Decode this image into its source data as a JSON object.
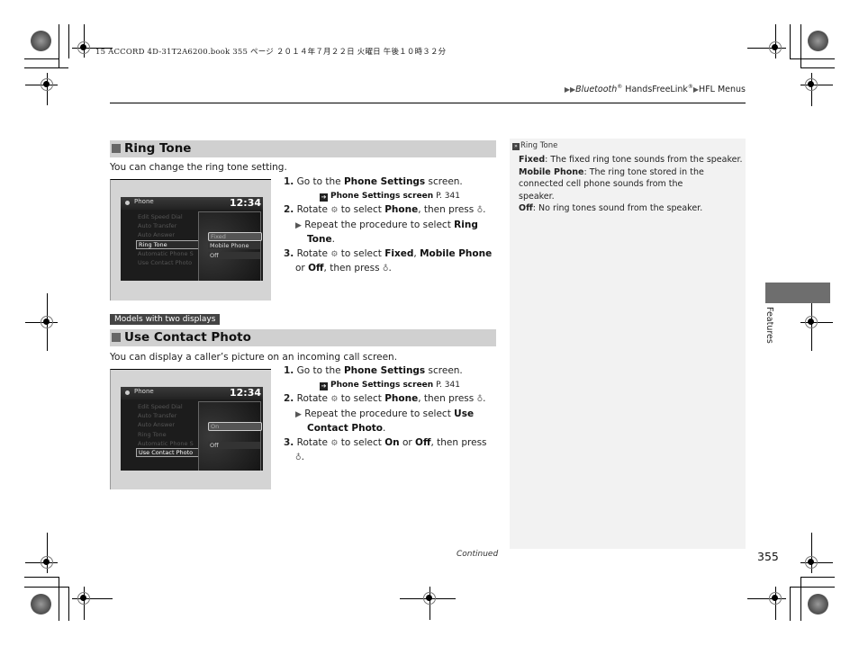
{
  "print_header": "15 ACCORD 4D-31T2A6200.book  355 ページ  ２０１４年７月２２日  火曜日  午後１０時３２分",
  "breadcrumb": {
    "arrow": "▶▶",
    "part1": "Bluetooth",
    "reg1": "®",
    "part2": " HandsFreeLink",
    "reg2": "®",
    "arrow2": "▶",
    "part3": "HFL Menus"
  },
  "sections": [
    {
      "title": "Ring Tone",
      "intro": "You can change the ring tone setting.",
      "screen": {
        "title": "Phone",
        "time": "12:34",
        "menu_items": [
          "Edit Speed Dial",
          "Auto Transfer",
          "Auto Answer",
          "Ring Tone",
          "Automatic Phone S",
          "Use Contact Photo"
        ],
        "selected_menu": "Ring Tone",
        "options": [
          "Fixed",
          "Mobile Phone",
          "Off"
        ],
        "selected_option": "Fixed"
      },
      "steps": {
        "s1_num": "1.",
        "s1_pre": " Go to the ",
        "s1_bold": "Phone Settings",
        "s1_post": " screen.",
        "ref_bold": "Phone Settings screen",
        "ref_page": " P. 341",
        "s2_num": "2.",
        "s2_pre": " Rotate ",
        "s2_mid": " to select ",
        "s2_bold": "Phone",
        "s2_post": ", then press ",
        "s2_sub_pre": "Repeat the procedure to select ",
        "s2_sub_bold1": "Ring",
        "s2_sub_bold2": "Tone",
        "s2_sub_post": ".",
        "s3_num": "3.",
        "s3_pre": " Rotate ",
        "s3_mid": " to select ",
        "s3_b1": "Fixed",
        "s3_c1": ", ",
        "s3_b2": "Mobile Phone",
        "s3_line2_pre": "or ",
        "s3_b3": "Off",
        "s3_post": ", then press "
      }
    },
    {
      "badge": "Models with two displays",
      "title": "Use Contact Photo",
      "intro": "You can display a caller’s picture on an incoming call screen.",
      "screen": {
        "title": "Phone",
        "time": "12:34",
        "menu_items": [
          "Edit Speed Dial",
          "Auto Transfer",
          "Auto Answer",
          "Ring Tone",
          "Automatic Phone S",
          "Use Contact Photo"
        ],
        "selected_menu": "Use Contact Photo",
        "options": [
          "On",
          "Off"
        ],
        "selected_option": "On"
      },
      "steps": {
        "s1_num": "1.",
        "s1_pre": " Go to the ",
        "s1_bold": "Phone Settings",
        "s1_post": " screen.",
        "ref_bold": "Phone Settings screen",
        "ref_page": " P. 341",
        "s2_num": "2.",
        "s2_pre": " Rotate ",
        "s2_mid": " to select ",
        "s2_bold": "Phone",
        "s2_post": ", then press ",
        "s2_sub_pre": "Repeat the procedure to select ",
        "s2_sub_bold1": "Use",
        "s2_sub_bold2": "Contact Photo",
        "s2_sub_post": ".",
        "s3_num": "3.",
        "s3_pre": " Rotate ",
        "s3_mid": " to select ",
        "s3_b1": "On",
        "s3_c1": " or ",
        "s3_b2": "Off",
        "s3_post": ", then press"
      }
    }
  ],
  "sidebar": {
    "ref_icon": "»",
    "title": "Ring Tone",
    "entries": [
      {
        "term": "Fixed",
        "desc": ": The fixed ring tone sounds from the speaker."
      },
      {
        "term": "Mobile Phone",
        "desc": ": The ring tone stored in the connected cell phone sounds from the speaker."
      },
      {
        "term": "Off",
        "desc": ": No ring tones sound from the speaker."
      }
    ]
  },
  "side_tab": "Features",
  "continued": "Continued",
  "page_number": "355",
  "icons": {
    "dial": "interface-dial-icon",
    "press": "press-dial-icon",
    "ref": "cross-reference-icon",
    "arrow": "▶"
  }
}
